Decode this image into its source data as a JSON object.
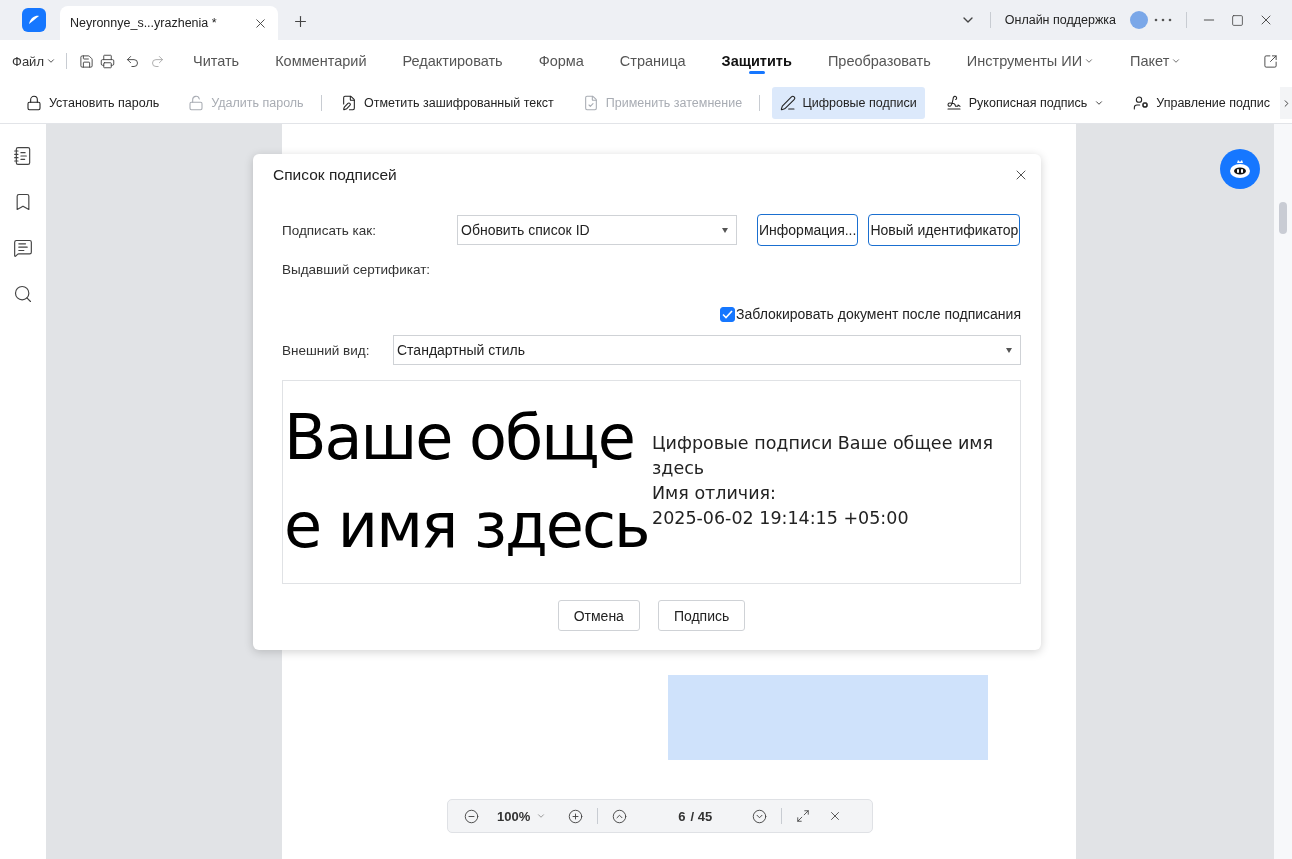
{
  "window": {
    "tab": {
      "title": "Neyronnye_s...yrazhenia *",
      "selected": true
    },
    "support": "Онлайн поддержка"
  },
  "menu": {
    "file": "Файл",
    "tabs": [
      {
        "label": "Читать",
        "selected": false,
        "caret": false
      },
      {
        "label": "Комментарий",
        "selected": false,
        "caret": false
      },
      {
        "label": "Редактировать",
        "selected": false,
        "caret": false
      },
      {
        "label": "Форма",
        "selected": false,
        "caret": false
      },
      {
        "label": "Страница",
        "selected": false,
        "caret": false
      },
      {
        "label": "Защитить",
        "selected": true,
        "caret": false
      },
      {
        "label": "Преобразовать",
        "selected": false,
        "caret": false
      },
      {
        "label": "Инструменты ИИ",
        "selected": false,
        "caret": true
      },
      {
        "label": "Пакет",
        "selected": false,
        "caret": true
      }
    ]
  },
  "toolbar": [
    {
      "kind": "lock",
      "label": "Установить пароль",
      "disabled": false,
      "selected": false,
      "caret": false
    },
    {
      "kind": "unlock",
      "label": "Удалить пароль",
      "disabled": true,
      "selected": false,
      "caret": false
    },
    {
      "kind": "mark",
      "label": "Отметить зашифрованный текст",
      "disabled": false,
      "selected": false,
      "caret": false
    },
    {
      "kind": "redact",
      "label": "Применить затемнение",
      "disabled": true,
      "selected": false,
      "caret": false
    },
    {
      "kind": "digital",
      "label": "Цифровые подписи",
      "disabled": false,
      "selected": true,
      "caret": false
    },
    {
      "kind": "hand",
      "label": "Рукописная подпись",
      "disabled": false,
      "selected": false,
      "caret": true
    },
    {
      "kind": "manage",
      "label": "Управление подпис",
      "disabled": false,
      "selected": false,
      "caret": false
    }
  ],
  "dialog": {
    "title": "Список подписей",
    "sign_as": {
      "label": "Подписать как:",
      "value": "Обновить список ID"
    },
    "buttons": [
      "Информация...",
      "Новый идентификатор"
    ],
    "issuer": {
      "label": "Выдавший сертификат:"
    },
    "lock_after": {
      "label": "Заблокировать документ после подписания",
      "checked": true
    },
    "appearance": {
      "label": "Внешний вид:",
      "value": "Стандартный стиль"
    },
    "preview": {
      "name_lines": [
        "Ваше обще",
        "е имя здесь"
      ],
      "details": [
        "Цифровые подписи Ваше общее имя здесь",
        "Имя отличия:",
        "2025-06-02 19:14:15 +05:00"
      ]
    },
    "actions": [
      "Отмена",
      "Подпись"
    ]
  },
  "zoom_bar": {
    "zoom": "100%",
    "page": "6",
    "total": "/ 45"
  }
}
